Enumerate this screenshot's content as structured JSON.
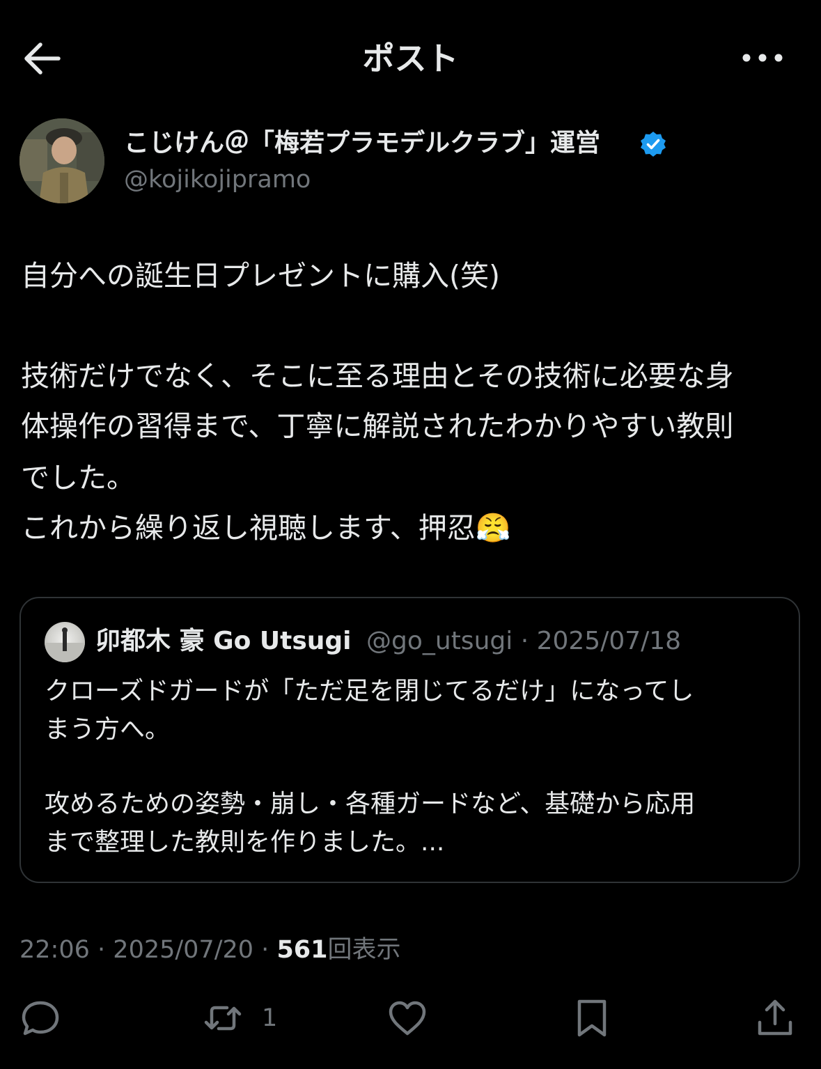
{
  "header": {
    "title": "ポスト"
  },
  "author": {
    "name": "こじけん＠「梅若プラモデルクラブ」運営",
    "handle": "@kojikojipramo",
    "verified_color": "#1d9bf0"
  },
  "post": {
    "lines": [
      "自分への誕生日プレゼントに購入(笑)",
      "技術だけでなく、そこに至る理由とその技術に必要な身",
      "体操作の習得まで、丁寧に解説されたわかりやすい教則",
      "でした。",
      "これから繰り返し視聴します、押忍"
    ],
    "emoji": "😤"
  },
  "quote": {
    "name": "卯都木 豪 Go Utsugi",
    "handle": "@go_utsugi",
    "separator": "·",
    "date": "2025/07/18",
    "lines": [
      "クローズドガードが「ただ足を閉じてるだけ」になってし",
      "まう方へ。",
      "攻めるための姿勢・崩し・各種ガードなど、基礎から応用",
      "まで整理した教則を作りました。..."
    ]
  },
  "meta": {
    "time": "22:06",
    "sep1": "·",
    "date": "2025/07/20",
    "sep2": "·",
    "views_count": "561",
    "views_label": "回表示"
  },
  "actions": {
    "reply_icon": "reply-icon",
    "retweet_icon": "retweet-icon",
    "retweet_count": "1",
    "like_icon": "heart-icon",
    "bookmark_icon": "bookmark-icon",
    "share_icon": "share-icon"
  }
}
